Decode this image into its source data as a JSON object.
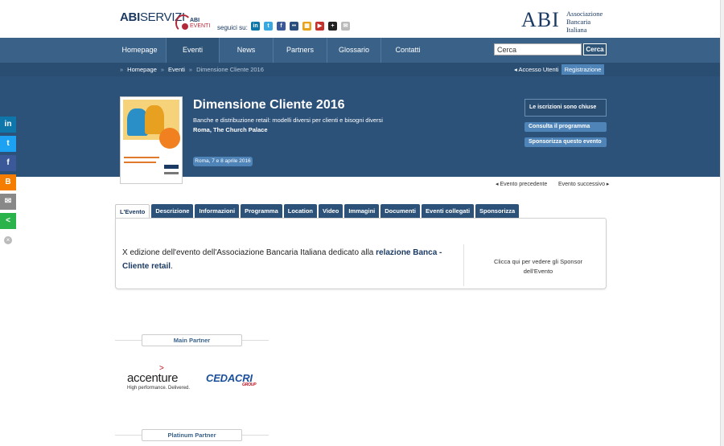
{
  "header": {
    "brand_bold": "ABI",
    "brand_light": "SERVIZI",
    "eventi_abi": "ABI",
    "eventi_label": "EVENTI",
    "follow_label": "seguici su:",
    "social_icons": [
      "linkedin-icon",
      "twitter-icon",
      "facebook-icon",
      "flickr-icon",
      "delicious-icon",
      "youtube-icon",
      "googleplus-icon",
      "email-icon"
    ],
    "abi_logo": "ABI",
    "abi_assoc_1": "Associazione",
    "abi_assoc_2": "Bancaria",
    "abi_assoc_3": "Italiana"
  },
  "nav": {
    "items": [
      {
        "label": "Homepage"
      },
      {
        "label": "Eventi"
      },
      {
        "label": "News"
      },
      {
        "label": "Partners"
      },
      {
        "label": "Glossario"
      },
      {
        "label": "Contatti"
      }
    ],
    "search_value": "Cerca",
    "search_button": "Cerca"
  },
  "breadcrumb": {
    "items": [
      "Homepage",
      "Eventi",
      "Dimensione Cliente 2016"
    ],
    "separator": "»",
    "login_label": "Accesso Utenti",
    "register_label": "Registrazione"
  },
  "event": {
    "title": "Dimensione Cliente 2016",
    "subtitle": "Banche e distribuzione retail: modelli diversi per clienti e bisogni diversi",
    "place": "Roma, The Church Palace",
    "dates": "Roma, 7 e 8 aprile 2016",
    "closed_label": "Le iscrizioni sono chiuse",
    "program_button": "Consulta il programma",
    "sponsor_button": "Sponsorizza questo evento"
  },
  "pager": {
    "prev": "Evento precedente",
    "next": "Evento successivo"
  },
  "tabs": [
    {
      "label": "L'Evento"
    },
    {
      "label": "Descrizione"
    },
    {
      "label": "Informazioni"
    },
    {
      "label": "Programma"
    },
    {
      "label": "Location"
    },
    {
      "label": "Video"
    },
    {
      "label": "Immagini"
    },
    {
      "label": "Documenti"
    },
    {
      "label": "Eventi collegati"
    },
    {
      "label": "Sponsorizza"
    }
  ],
  "panel": {
    "text_prefix": "X edizione dell'evento dell'Associazione Bancaria Italiana dedicato alla ",
    "text_bold": "relazione Banca - Cliente retail",
    "text_suffix": ".",
    "sponsor_link": "Clicca qui per vedere gli Sponsor dell'Evento"
  },
  "partners": {
    "main_label": "Main Partner",
    "platinum_label": "Platinum Partner",
    "accenture_name": "accenture",
    "accenture_tagline": "High performance. Delivered.",
    "cedacri_name": "CEDACRI",
    "cedacri_group": "GROUP"
  },
  "colors": {
    "nav_blue": "#3a6289",
    "hero_blue": "#2c527a",
    "accent_blue": "#4f84b8"
  }
}
